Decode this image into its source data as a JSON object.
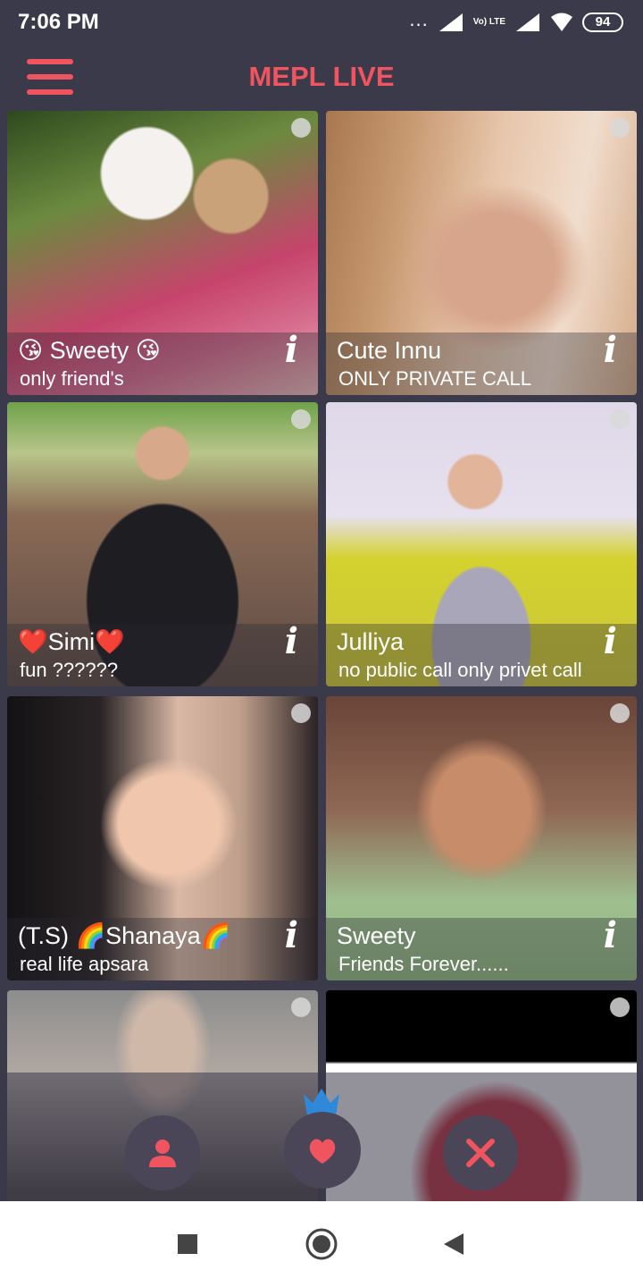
{
  "status_bar": {
    "time": "7:06 PM",
    "dots": "...",
    "volte": "Vo) LTE",
    "battery": "94"
  },
  "app_bar": {
    "title": "MEPL LIVE",
    "menu_icon": "hamburger-menu-icon"
  },
  "colors": {
    "accent": "#f0545f",
    "background": "#3b3a4a",
    "nav_button": "#4a4658",
    "crown": "#2f88d8"
  },
  "cards": [
    {
      "name": "😘 Sweety 😘",
      "tagline": "only friend's",
      "info": "i"
    },
    {
      "name": "Cute Innu",
      "tagline": "ONLY PRIVATE CALL",
      "info": "i"
    },
    {
      "name": "❤️Simi❤️",
      "tagline": "fun ??????",
      "info": "i"
    },
    {
      "name": "Julliya",
      "tagline": "no public call only privet call",
      "info": "i"
    },
    {
      "name": "(T.S) 🌈Shanaya🌈",
      "tagline": "real life apsara",
      "info": "i"
    },
    {
      "name": "Sweety",
      "tagline": "Friends Forever......",
      "info": "i"
    },
    {
      "name": "",
      "tagline": "",
      "info": ""
    },
    {
      "name": "",
      "tagline": "",
      "info": ""
    }
  ],
  "bottom_nav": {
    "items": [
      "profile-icon",
      "heart-icon",
      "tools-icon"
    ],
    "crown_icon": "crown-icon"
  },
  "system_nav": {
    "items": [
      "recents-square-icon",
      "home-circle-icon",
      "back-triangle-icon"
    ]
  }
}
